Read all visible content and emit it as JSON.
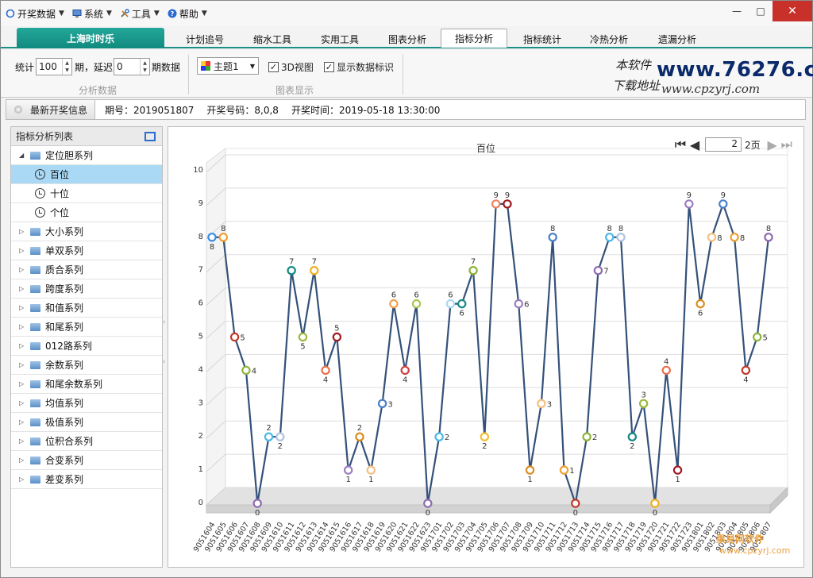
{
  "menu": [
    {
      "label": "开奖数据",
      "icon": "circle-icon"
    },
    {
      "label": "系统",
      "icon": "monitor-icon"
    },
    {
      "label": "工具",
      "icon": "tools-icon"
    },
    {
      "label": "帮助",
      "icon": "help-icon"
    }
  ],
  "window": {
    "minimize": "—",
    "maximize": "□",
    "close": "✕"
  },
  "brand": "上海时时乐",
  "tabs": [
    "计划追号",
    "缩水工具",
    "实用工具",
    "图表分析",
    "指标分析",
    "指标统计",
    "冷热分析",
    "遗漏分析"
  ],
  "active_tab": "指标分析",
  "toolbar": {
    "stat_label": "统计",
    "stat_value": "100",
    "period_label": "期，延迟",
    "delay_value": "0",
    "period_data_label": "期数据",
    "group1": "分析数据",
    "theme_value": "主题1",
    "view3d_label": "3D视图",
    "view3d_checked": "✓",
    "show_label": "显示数据标识",
    "show_checked": "✓",
    "group2": "图表显示"
  },
  "logo": {
    "cn1": "本软件",
    "cn2": "下载地址",
    "url1": "www.76276.com",
    "url2": "www.cpzyrj.com"
  },
  "info": {
    "latest": "最新开奖信息",
    "issue_label": "期号：",
    "issue": "2019051807",
    "code_label": "开奖号码：",
    "code": "8,0,8",
    "time_label": "开奖时间：",
    "time": "2019-05-18 13:30:00"
  },
  "left": {
    "title": "指标分析列表",
    "items": [
      {
        "label": "定位胆系列",
        "type": "open"
      },
      {
        "label": "百位",
        "type": "leaf",
        "selected": true
      },
      {
        "label": "十位",
        "type": "leaf"
      },
      {
        "label": "个位",
        "type": "leaf"
      },
      {
        "label": "大小系列",
        "type": "closed"
      },
      {
        "label": "单双系列",
        "type": "closed"
      },
      {
        "label": "质合系列",
        "type": "closed"
      },
      {
        "label": "跨度系列",
        "type": "closed"
      },
      {
        "label": "和值系列",
        "type": "closed"
      },
      {
        "label": "和尾系列",
        "type": "closed"
      },
      {
        "label": "012路系列",
        "type": "closed"
      },
      {
        "label": "余数系列",
        "type": "closed"
      },
      {
        "label": "和尾余数系列",
        "type": "closed"
      },
      {
        "label": "均值系列",
        "type": "closed"
      },
      {
        "label": "极值系列",
        "type": "closed"
      },
      {
        "label": "位积合系列",
        "type": "closed"
      },
      {
        "label": "合变系列",
        "type": "closed"
      },
      {
        "label": "差变系列",
        "type": "closed"
      }
    ]
  },
  "pager": {
    "page": "2",
    "total": "2页"
  },
  "watermark": {
    "line1": "果易网软件",
    "line2": "www.cpzyrj.com"
  },
  "chart_data": {
    "type": "line",
    "title": "百位",
    "ylim": [
      0,
      10
    ],
    "yticks": [
      0,
      1,
      2,
      3,
      4,
      5,
      6,
      7,
      8,
      9,
      10
    ],
    "grid": true,
    "categories": [
      "9051604",
      "9051605",
      "9051606",
      "9051607",
      "9051608",
      "9051609",
      "9051610",
      "9051611",
      "9051612",
      "9051613",
      "9051614",
      "9051615",
      "9051616",
      "9051617",
      "9051618",
      "9051619",
      "9051620",
      "9051621",
      "9051622",
      "9051623",
      "9051701",
      "9051702",
      "9051703",
      "9051704",
      "9051705",
      "9051706",
      "9051707",
      "9051708",
      "9051709",
      "9051710",
      "9051711",
      "9051712",
      "9051713",
      "9051714",
      "9051715",
      "9051716",
      "9051717",
      "9051718",
      "9051719",
      "9051720",
      "9051721",
      "9051722",
      "9051723",
      "9051801",
      "9051802",
      "9051803",
      "9051804",
      "9051805",
      "9051806",
      "9051807"
    ],
    "values": [
      8,
      8,
      5,
      4,
      0,
      2,
      2,
      7,
      5,
      7,
      4,
      5,
      1,
      2,
      1,
      3,
      6,
      4,
      6,
      0,
      2,
      6,
      6,
      7,
      2,
      9,
      9,
      6,
      1,
      3,
      8,
      1,
      0,
      2,
      7,
      8,
      8,
      2,
      3,
      0,
      4,
      1,
      9,
      6,
      8,
      9,
      8,
      4,
      5,
      8
    ],
    "marker_colors": [
      "#3a8de0",
      "#f0a030",
      "#c0392b",
      "#8db33a",
      "#8e6bb0",
      "#4db8e8",
      "#b0c4de",
      "#138a84",
      "#9ab93a",
      "#f0b020",
      "#e8704a",
      "#a01820",
      "#9c7cc0",
      "#d98d20",
      "#f2c080",
      "#4a80c8",
      "#f0a050",
      "#d04040",
      "#a8c850",
      "#8e6bb0",
      "#4db8e8",
      "#a8d8f0",
      "#138a84",
      "#8db33a",
      "#f0c030",
      "#f08060",
      "#a01820",
      "#9c7cc0",
      "#d98d20",
      "#f2c080",
      "#4a80c8",
      "#f0a030",
      "#c0392b",
      "#8db33a",
      "#8e6bb0",
      "#4db8e8",
      "#b0c4de",
      "#138a84",
      "#9ab93a",
      "#f0b020",
      "#e8704a",
      "#a01820",
      "#9c7cc0",
      "#d98d20",
      "#f2c080",
      "#4a80c8",
      "#f0a030",
      "#c0392b",
      "#8db33a",
      "#8e6bb0"
    ]
  }
}
